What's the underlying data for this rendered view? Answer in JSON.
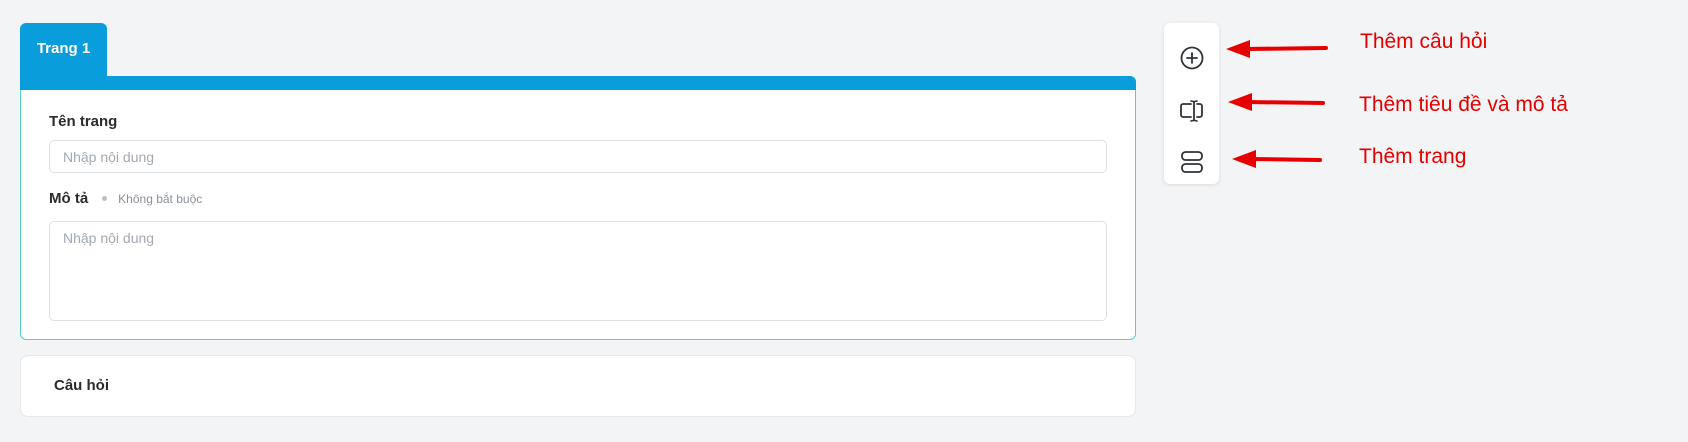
{
  "tab": {
    "label": "Trang 1"
  },
  "form": {
    "page_name_label": "Tên trang",
    "page_name_placeholder": "Nhập nội dung",
    "description_label": "Mô tả",
    "description_hint": "Không bắt buộc",
    "description_placeholder": "Nhập nội dung"
  },
  "questions_section": {
    "label": "Câu hỏi"
  },
  "toolbar": {
    "items": [
      {
        "icon": "plus-circle-icon"
      },
      {
        "icon": "text-title-icon"
      },
      {
        "icon": "add-page-icon"
      }
    ]
  },
  "annotations": [
    {
      "text": "Thêm câu hỏi"
    },
    {
      "text": "Thêm tiêu đề và mô tả"
    },
    {
      "text": "Thêm trang"
    }
  ],
  "colors": {
    "accent": "#0a9ddb",
    "card_border": "#56cdd6",
    "annotation": "#e60000",
    "background": "#f3f4f6"
  }
}
